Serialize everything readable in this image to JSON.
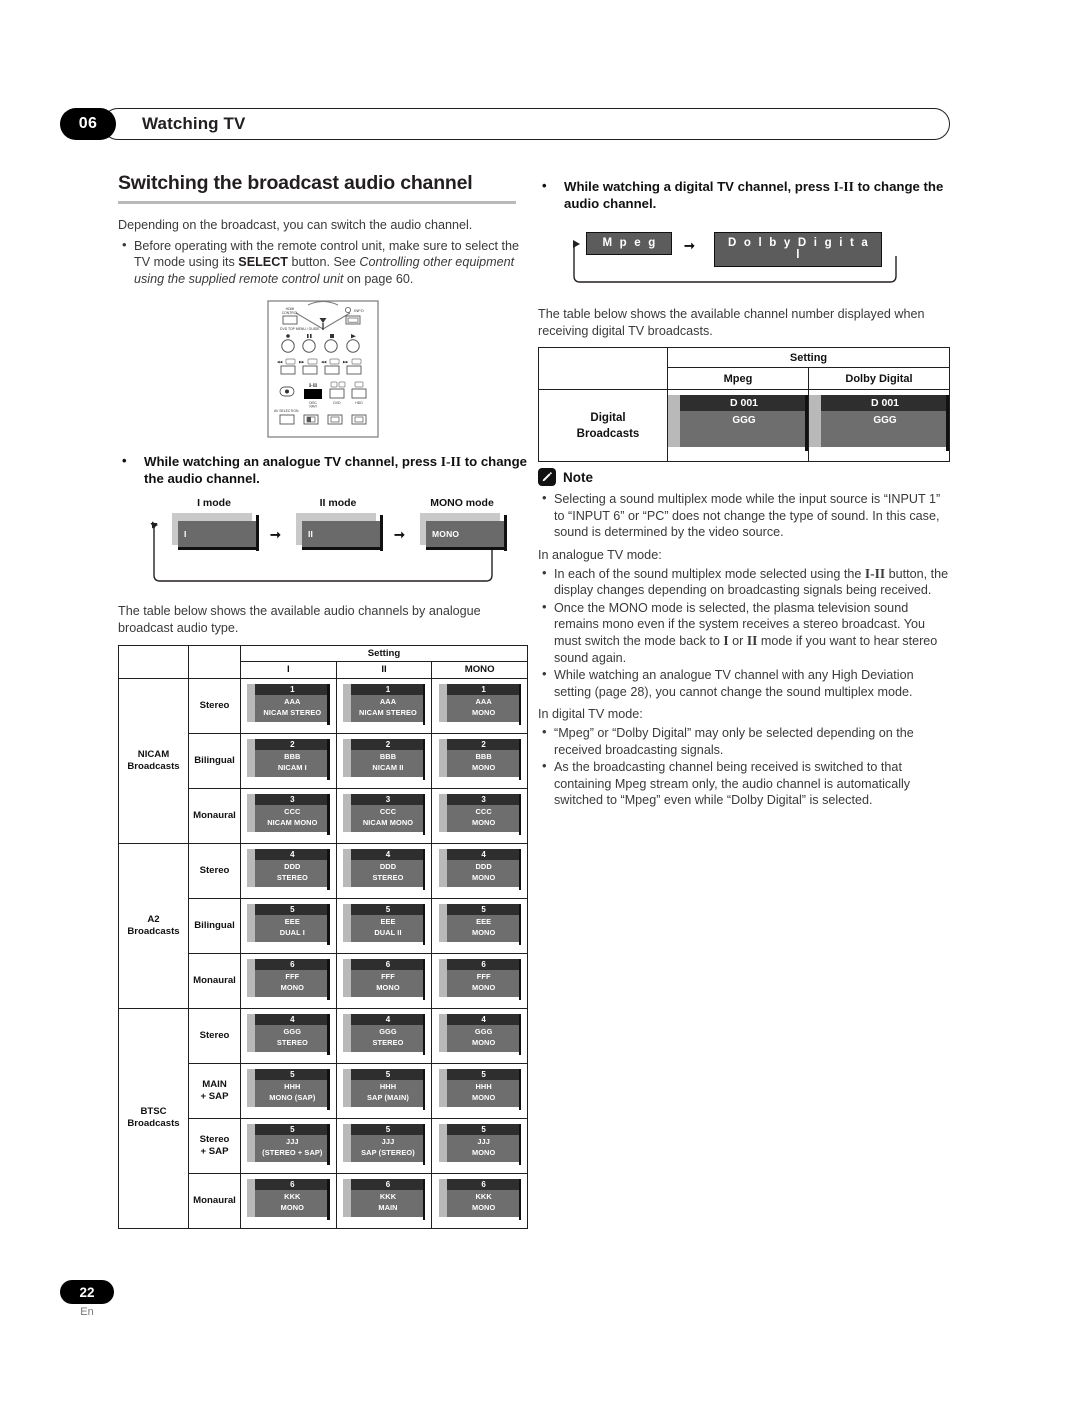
{
  "header": {
    "chapter_number": "06",
    "chapter_title": "Watching TV"
  },
  "footer": {
    "page_number": "22",
    "language": "En"
  },
  "left_column": {
    "section_title": "Switching the broadcast audio channel",
    "intro": "Depending on the broadcast, you can switch the audio channel.",
    "bullet_1_part1": "Before operating with the remote control unit, make sure to select the TV mode using its ",
    "bullet_1_bold": "SELECT",
    "bullet_1_part2": " button. See ",
    "bullet_1_italic": "Controlling other equipment using the supplied remote control unit",
    "bullet_1_part3": " on page 60.",
    "remote": {
      "label_hdmi_control": "HDMI CONTROL",
      "label_info": "INFO",
      "label_dvd_top_menu": "DVD TOP MENU / GUIDE",
      "label_i_ii": "I-II",
      "label_disc_navi": "DISC NAVI",
      "label_dvd": "DVD",
      "label_hdd": "HDD",
      "label_av_selection": "AV SELECTION"
    },
    "analogue_lead": {
      "bold_part1": "While watching an analogue TV channel, press ",
      "key": "I-II",
      "bold_part2": " to change the audio channel."
    },
    "analogue_flow": {
      "labels": [
        "I mode",
        "II mode",
        "MONO mode"
      ],
      "box_texts": [
        "I",
        "II",
        "MONO"
      ]
    },
    "table_intro": "The table below shows the available audio channels by analogue broadcast audio type.",
    "analogue_table": {
      "setting_header": "Setting",
      "columns": [
        "I",
        "II",
        "MONO"
      ],
      "groups": [
        {
          "name": "NICAM Broadcasts",
          "rows": [
            {
              "label": "Stereo",
              "cells": [
                {
                  "num": "1",
                  "l1": "AAA",
                  "l2": "NICAM STEREO"
                },
                {
                  "num": "1",
                  "l1": "AAA",
                  "l2": "NICAM STEREO"
                },
                {
                  "num": "1",
                  "l1": "AAA",
                  "l2": "MONO"
                }
              ]
            },
            {
              "label": "Bilingual",
              "cells": [
                {
                  "num": "2",
                  "l1": "BBB",
                  "l2": "NICAM I"
                },
                {
                  "num": "2",
                  "l1": "BBB",
                  "l2": "NICAM II"
                },
                {
                  "num": "2",
                  "l1": "BBB",
                  "l2": "MONO"
                }
              ]
            },
            {
              "label": "Monaural",
              "cells": [
                {
                  "num": "3",
                  "l1": "CCC",
                  "l2": "NICAM MONO"
                },
                {
                  "num": "3",
                  "l1": "CCC",
                  "l2": "NICAM MONO"
                },
                {
                  "num": "3",
                  "l1": "CCC",
                  "l2": "MONO"
                }
              ]
            }
          ]
        },
        {
          "name": "A2 Broadcasts",
          "rows": [
            {
              "label": "Stereo",
              "cells": [
                {
                  "num": "4",
                  "l1": "DDD",
                  "l2": "STEREO"
                },
                {
                  "num": "4",
                  "l1": "DDD",
                  "l2": "STEREO"
                },
                {
                  "num": "4",
                  "l1": "DDD",
                  "l2": "MONO"
                }
              ]
            },
            {
              "label": "Bilingual",
              "cells": [
                {
                  "num": "5",
                  "l1": "EEE",
                  "l2": "DUAL I"
                },
                {
                  "num": "5",
                  "l1": "EEE",
                  "l2": "DUAL II"
                },
                {
                  "num": "5",
                  "l1": "EEE",
                  "l2": "MONO"
                }
              ]
            },
            {
              "label": "Monaural",
              "cells": [
                {
                  "num": "6",
                  "l1": "FFF",
                  "l2": "MONO"
                },
                {
                  "num": "6",
                  "l1": "FFF",
                  "l2": "MONO"
                },
                {
                  "num": "6",
                  "l1": "FFF",
                  "l2": "MONO"
                }
              ]
            }
          ]
        },
        {
          "name": "BTSC Broadcasts",
          "rows": [
            {
              "label": "Stereo",
              "cells": [
                {
                  "num": "4",
                  "l1": "GGG",
                  "l2": "STEREO"
                },
                {
                  "num": "4",
                  "l1": "GGG",
                  "l2": "STEREO"
                },
                {
                  "num": "4",
                  "l1": "GGG",
                  "l2": "MONO"
                }
              ]
            },
            {
              "label": "MAIN + SAP",
              "cells": [
                {
                  "num": "5",
                  "l1": "HHH",
                  "l2": "MONO (SAP)"
                },
                {
                  "num": "5",
                  "l1": "HHH",
                  "l2": "SAP (MAIN)"
                },
                {
                  "num": "5",
                  "l1": "HHH",
                  "l2": "MONO"
                }
              ]
            },
            {
              "label": "Stereo + SAP",
              "cells": [
                {
                  "num": "5",
                  "l1": "JJJ",
                  "l2": "(STEREO + SAP)"
                },
                {
                  "num": "5",
                  "l1": "JJJ",
                  "l2": "SAP (STEREO)"
                },
                {
                  "num": "5",
                  "l1": "JJJ",
                  "l2": "MONO"
                }
              ]
            },
            {
              "label": "Monaural",
              "cells": [
                {
                  "num": "6",
                  "l1": "KKK",
                  "l2": "MONO"
                },
                {
                  "num": "6",
                  "l1": "KKK",
                  "l2": "MAIN"
                },
                {
                  "num": "6",
                  "l1": "KKK",
                  "l2": "MONO"
                }
              ]
            }
          ]
        }
      ]
    }
  },
  "right_column": {
    "digital_lead": {
      "bold_part1": "While watching a digital TV channel, press ",
      "key": "I-II",
      "bold_part2": " to change the audio channel."
    },
    "digital_flow": {
      "chips": [
        "M p e g",
        "D o l b y   D i g i t a l"
      ]
    },
    "table_intro": "The table below shows the available channel number displayed when receiving digital TV broadcasts.",
    "digital_table": {
      "setting_header": "Setting",
      "columns": [
        "Mpeg",
        "Dolby Digital"
      ],
      "row_label_line1": "Digital",
      "row_label_line2": "Broadcasts",
      "cells": [
        {
          "num": "D 001",
          "l1": "GGG"
        },
        {
          "num": "D 001",
          "l1": "GGG"
        }
      ]
    },
    "note": {
      "title": "Note",
      "bullet_1": "Selecting a sound multiplex mode while the input source is “INPUT 1” to “INPUT 6” or “PC” does not change the type of sound. In this case, sound is determined by the video source.",
      "analogue_heading": "In analogue TV mode:",
      "bullet_2_part1": "In each of the sound multiplex mode selected using the ",
      "bullet_2_key": "I-II",
      "bullet_2_part2": " button, the display changes depending on broadcasting signals being received.",
      "bullet_3_part1": "Once the MONO mode is selected, the plasma television sound remains mono even if the system receives a stereo broadcast. You must switch the mode back to ",
      "bullet_3_key1": "I",
      "bullet_3_mid": " or ",
      "bullet_3_key2": "II",
      "bullet_3_part2": " mode if you want to hear stereo sound again.",
      "bullet_4": "While watching an analogue TV channel with any High Deviation setting (page 28), you cannot change the sound multiplex mode.",
      "digital_heading": "In digital TV mode:",
      "bullet_5": "“Mpeg” or “Dolby Digital” may only be selected depending on the received broadcasting signals.",
      "bullet_6": "As the broadcasting channel being received is switched to that containing Mpeg stream only, the audio channel is automatically switched to “Mpeg” even while “Dolby Digital” is selected."
    }
  }
}
